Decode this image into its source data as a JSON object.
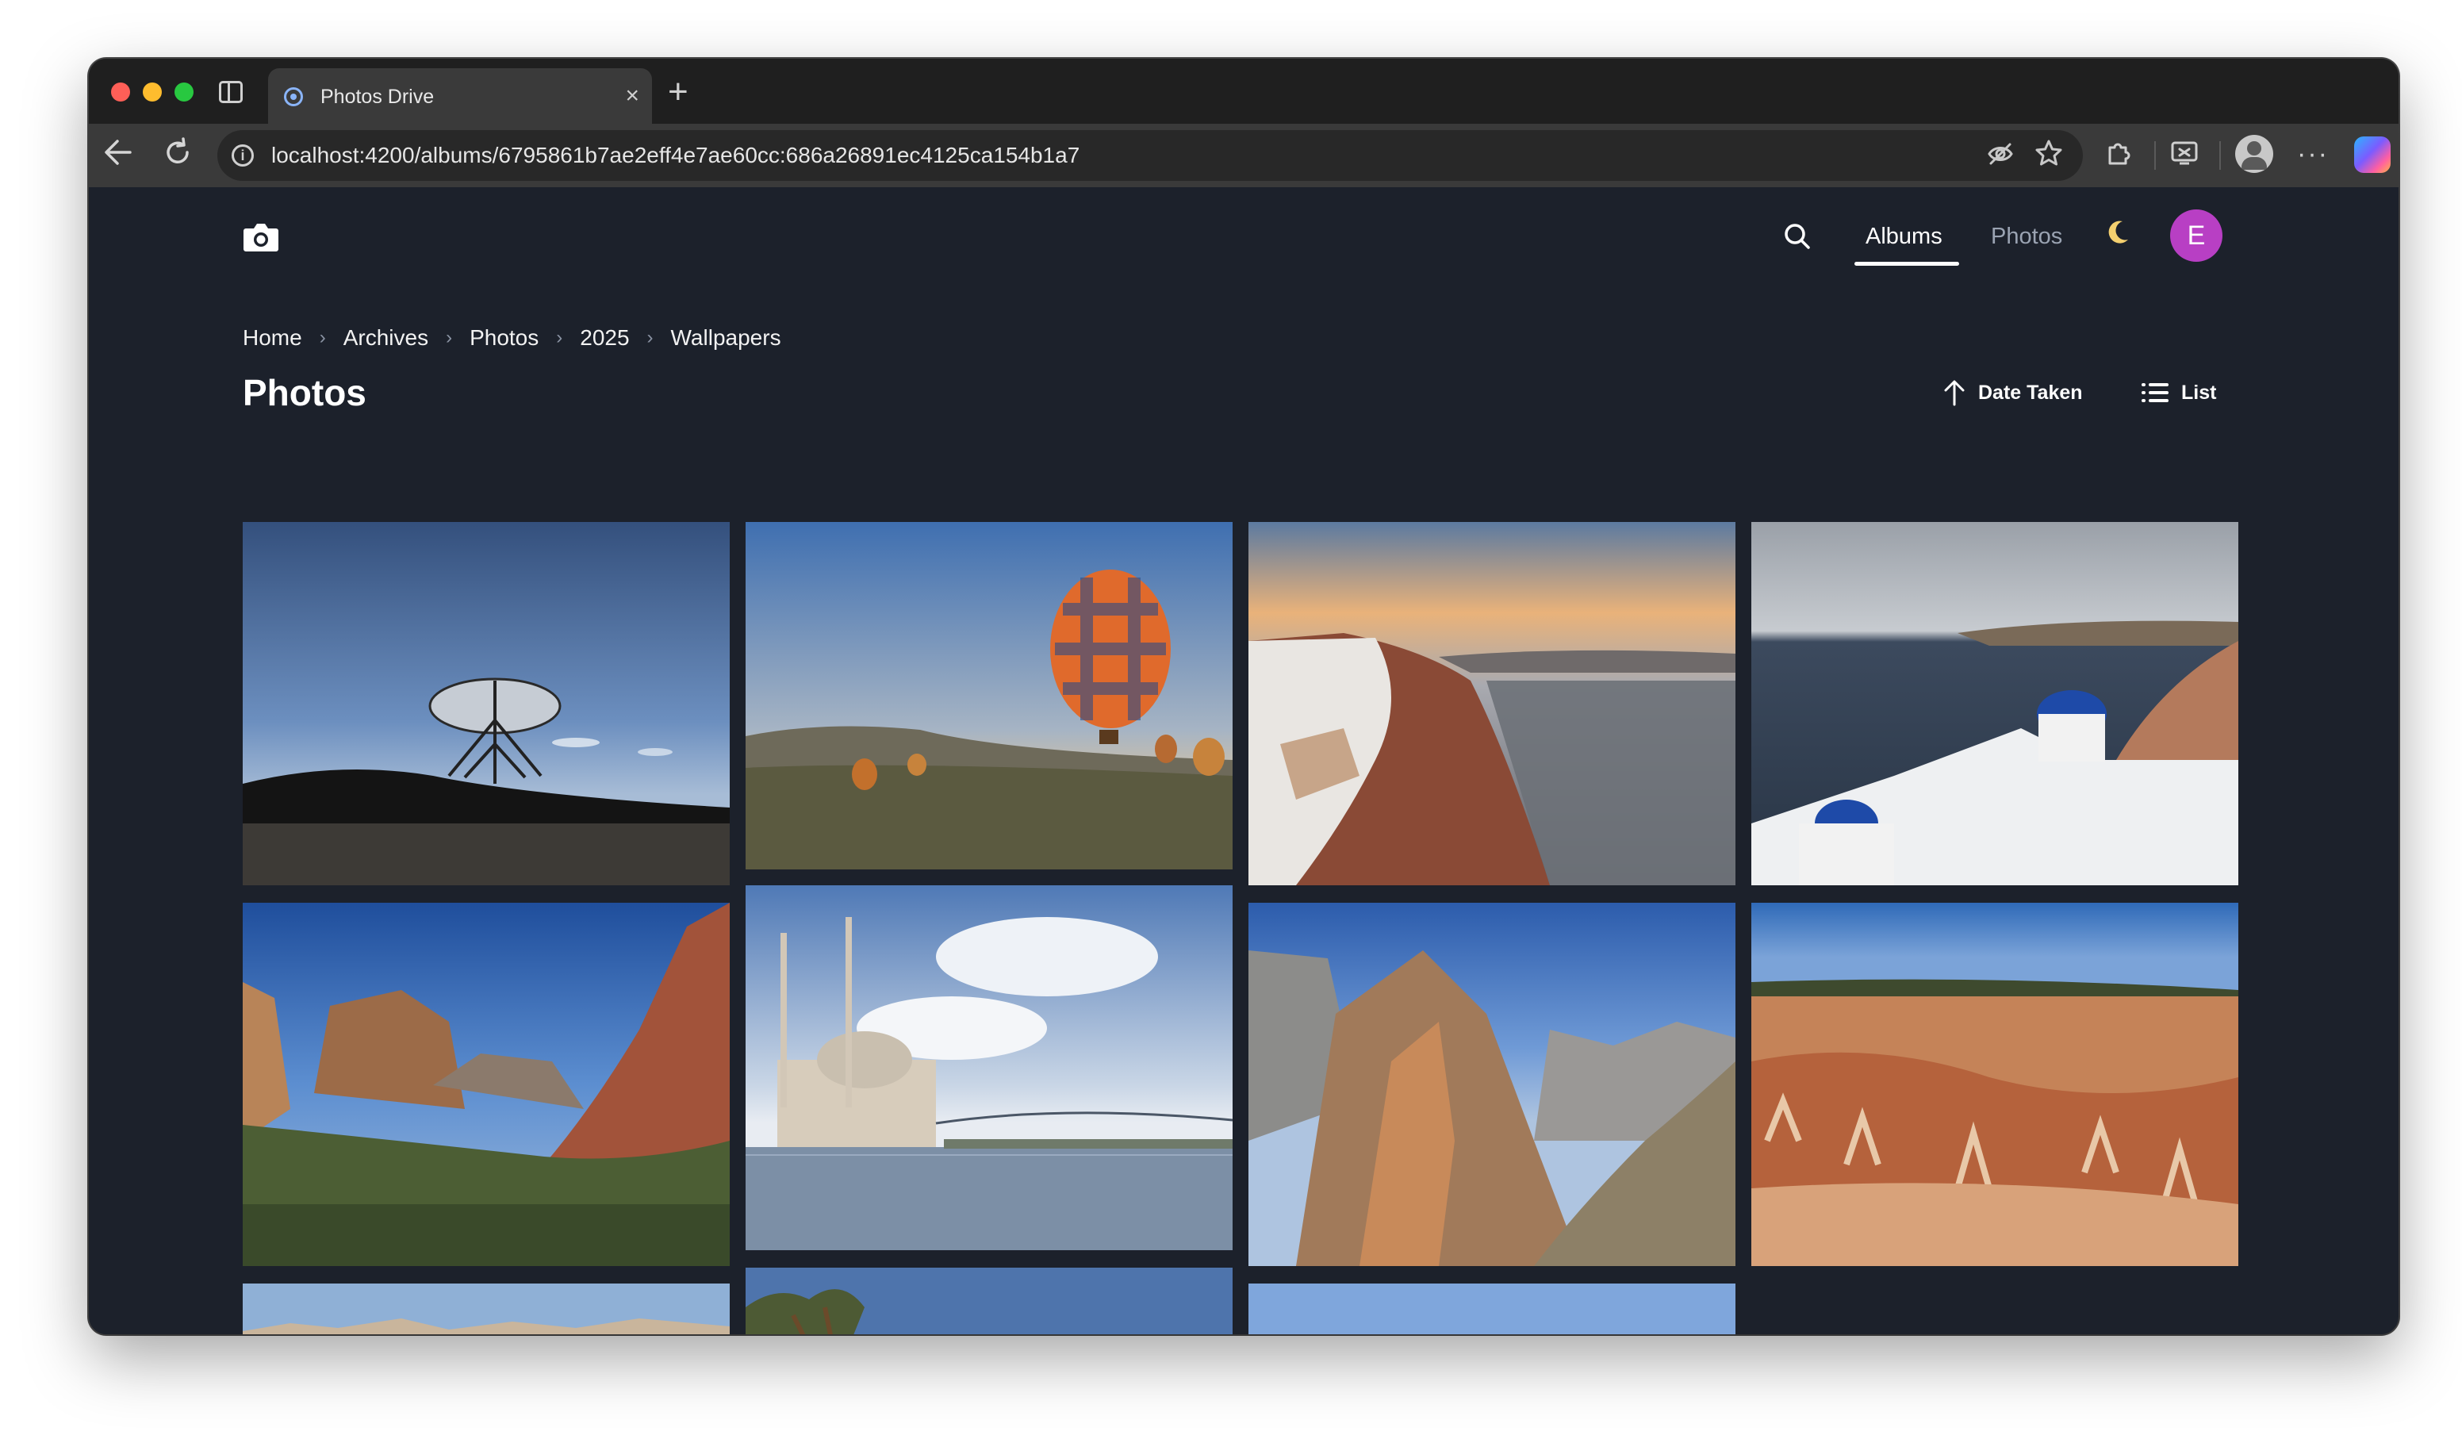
{
  "browser": {
    "tab_title": "Photos Drive",
    "tab_close": "×",
    "new_tab": "+",
    "url": "localhost:4200/albums/6795861b7ae2eff4e7ae60cc:686a26891ec4125ca154b1a7",
    "more": "···"
  },
  "header": {
    "nav_albums": "Albums",
    "nav_photos": "Photos",
    "avatar_initial": "E",
    "active_nav": "Albums"
  },
  "breadcrumb": [
    "Home",
    "Archives",
    "Photos",
    "2025",
    "Wallpapers"
  ],
  "page": {
    "title": "Photos",
    "sort_label": "Date Taken",
    "view_label": "List"
  },
  "photos": [
    {
      "name": "radio-telescope-dish"
    },
    {
      "name": "hot-air-balloons"
    },
    {
      "name": "santorini-sunset-cliffs"
    },
    {
      "name": "santorini-blue-domes"
    },
    {
      "name": "zion-canyon-peaks"
    },
    {
      "name": "istanbul-mosque-bosphorus"
    },
    {
      "name": "angels-landing-rock"
    },
    {
      "name": "bryce-canyon-hoodoos"
    },
    {
      "name": "desert-rock-horizon"
    },
    {
      "name": "pine-tree-blue-sky"
    },
    {
      "name": "clear-sky-landscape"
    }
  ],
  "colors": {
    "app_background": "#1c212b",
    "avatar": "#b83fc4",
    "tab_bar": "#1f1f1f",
    "toolbar": "#3a3a3a"
  }
}
